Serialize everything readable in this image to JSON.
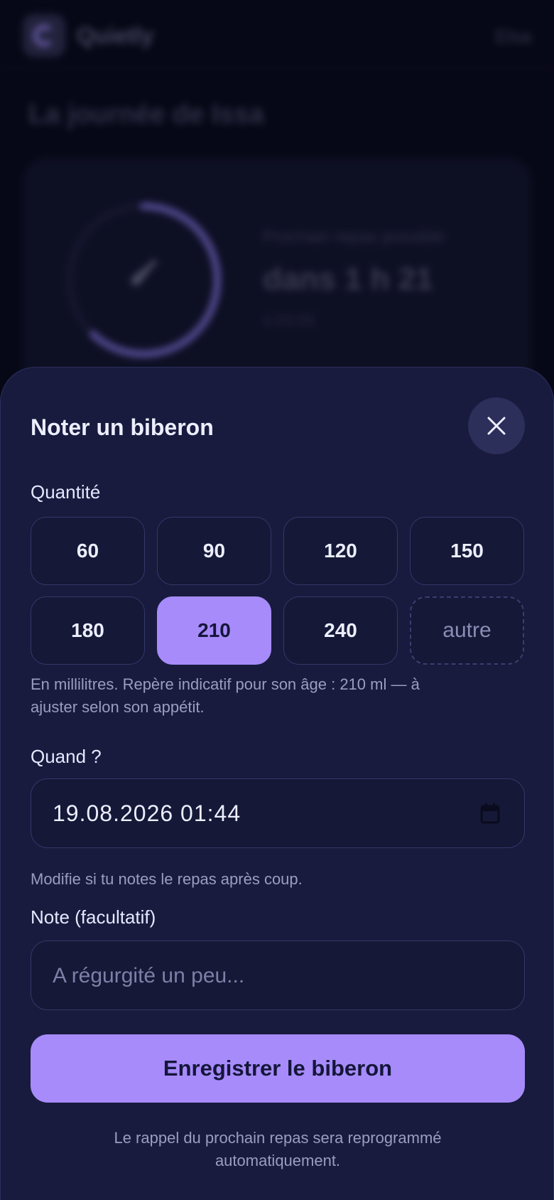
{
  "app": {
    "name": "Quietly",
    "user": "Elsa",
    "day_title": "La journée de Issa"
  },
  "next_meal": {
    "label": "Prochain repas possible",
    "value": "dans 1 h 21",
    "time": "à 03:05",
    "progress": 0.62
  },
  "sheet": {
    "title": "Noter un biberon",
    "quantity_label": "Quantité",
    "quantities": [
      "60",
      "90",
      "120",
      "150",
      "180",
      "210",
      "240"
    ],
    "selected_quantity": "210",
    "other_label": "autre",
    "quantity_hint_line1": "En millilitres. Repère indicatif pour son âge : 210 ml — à",
    "quantity_hint_line2": "ajuster selon son appétit.",
    "when_label": "Quand ?",
    "when_value": "19.08.2026 01:44",
    "when_hint": "Modifie si tu notes le repas après coup.",
    "note_label": "Note (facultatif)",
    "note_placeholder": "A régurgité un peu...",
    "submit_label": "Enregistrer le biberon",
    "footer_line1": "Le rappel du prochain repas sera reprogrammé",
    "footer_line2": "automatiquement."
  },
  "colors": {
    "accent": "#a78bfa",
    "sheet_bg": "#181b3d",
    "page_bg": "#070817"
  },
  "icons": {
    "close": "close-icon",
    "calendar": "calendar-icon",
    "bottle": "bottle-icon"
  }
}
